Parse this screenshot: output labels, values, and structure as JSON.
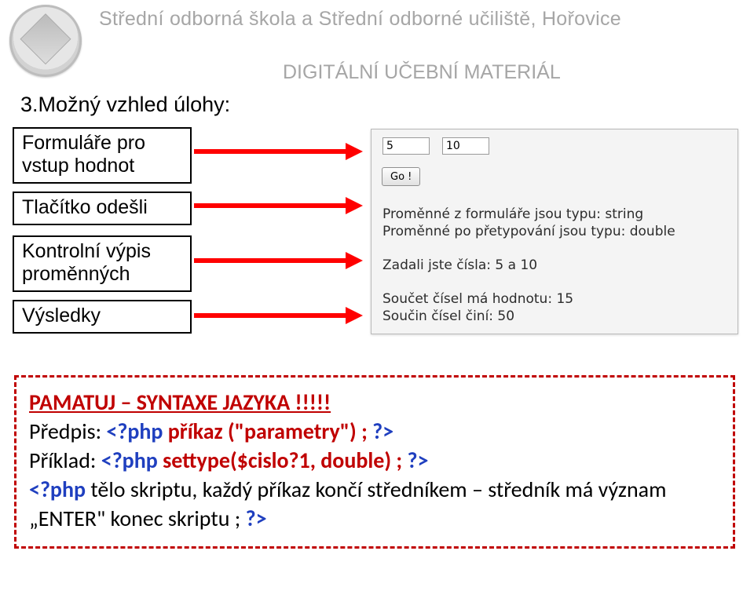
{
  "header": {
    "school": "Střední odborná škola a Střední odborné učiliště, Hořovice",
    "subtitle": "DIGITÁLNÍ UČEBNÍ MATERIÁL"
  },
  "section_heading": "3.Možný vzhled úlohy:",
  "labels": {
    "forms": "Formuláře pro vstup hodnot",
    "send_button": "Tlačítko odešli",
    "var_dump": "Kontrolní výpis proměnných",
    "results": "Výsledky"
  },
  "demo": {
    "input1": "5",
    "input2": "10",
    "go_label": "Go !",
    "line1": "Proměnné z formuláře jsou typu: string",
    "line2": "Proměnné po přetypování jsou typu: double",
    "line3": "Zadali jste čísla:   5 a 10",
    "line4": "Součet čísel má hodnotu:  15",
    "line5": "Součin čísel činí:  50"
  },
  "memo": {
    "title": "PAMATUJ – SYNTAXE JAZYKA !!!!!",
    "l2_prefix": "Předpis: ",
    "l2_open": "<?php",
    "l2_cmd": "  příkaz (\"parametry\")  ; ",
    "l2_close": "?>",
    "l3_prefix": "Příklad: ",
    "l3_open": "<?php",
    "l3_cmd": "   settype($cislo?1, double)  ; ",
    "l3_close": "?>",
    "l4_open": "<?php",
    "l4_body": "  tělo skriptu, každý příkaz končí středníkem – středník má význam „ENTER\"   konec skriptu  ;",
    "l4_close": "?>"
  }
}
